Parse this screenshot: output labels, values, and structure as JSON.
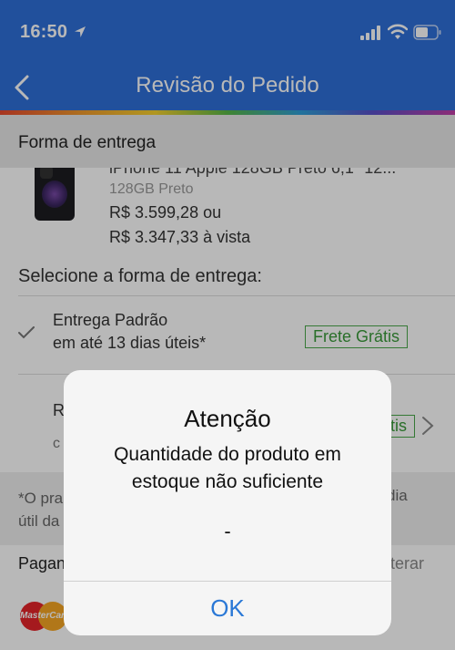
{
  "status_bar": {
    "time": "16:50"
  },
  "nav": {
    "title": "Revisão do Pedido"
  },
  "section": {
    "title": "Forma de entrega"
  },
  "product": {
    "name": "iPhone 11 Apple 128GB Preto 6,1\" 12...",
    "variant": "128GB Preto",
    "price_installment": "R$ 3.599,28 ou",
    "price_cash": "R$ 3.347,33 à vista"
  },
  "delivery": {
    "heading": "Selecione a forma de entrega:",
    "options": [
      {
        "title": "Entrega Padrão",
        "subtitle": "em até 13 dias úteis*",
        "badge": "Frete Grátis",
        "selected": true
      },
      {
        "title": "R",
        "subtitle": "c",
        "badge": "tis"
      }
    ],
    "note_left": "*O pra útil da",
    "note_right": "dia"
  },
  "payment": {
    "heading": "Pagan",
    "change_label": "lterar",
    "card_brand": "MasterCard"
  },
  "alert": {
    "title": "Atenção",
    "message": "Quantidade do produto em estoque não suficiente",
    "extra": "-",
    "ok_label": "OK"
  },
  "colors": {
    "nav_blue": "#2f6fd9",
    "accent_green": "#3a9a3a",
    "ok_blue": "#2a78d6"
  }
}
